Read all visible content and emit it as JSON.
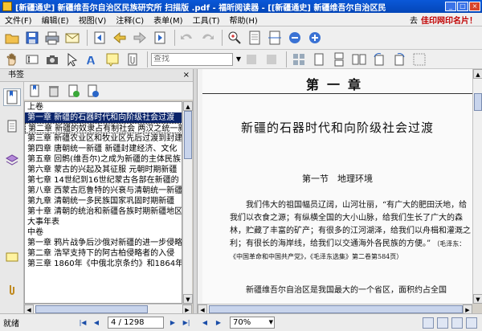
{
  "window": {
    "title": "[新疆通史] 新疆维吾尔自治区民族研究所 扫描版 .pdf - 福昕阅读器 - [[新疆通史] 新疆维吾尔自治区民"
  },
  "menu": {
    "items": [
      "文件(F)",
      "编辑(E)",
      "视图(V)",
      "注释(C)",
      "表单(M)",
      "工具(T)",
      "帮助(H)"
    ],
    "promo_prefix": "去",
    "promo_text": "佳印网印名片！"
  },
  "toolbar": {
    "search_placeholder": "查找",
    "icons": [
      "open-folder-icon",
      "save-icon",
      "print-icon",
      "email-icon",
      "first-page-icon",
      "previous-page-icon",
      "next-page-icon",
      "last-page-icon",
      "back-icon",
      "forward-icon",
      "zoom-in-icon",
      "fit-page-icon",
      "fit-width-icon",
      "zoom-out-icon",
      "zoom-options-icon"
    ]
  },
  "panel": {
    "title": "书签",
    "close_label": "×",
    "bookmarks": [
      "上卷",
      "第一章 新疆的石器时代和向阶级社会过渡",
      "第二章 新疆的奴隶占有制社会 两汉之统一新疆",
      "第三章 新疆农业区和牧业区先后过渡到封建",
      "第四章 唐朝统一新疆 新疆封建经济、文化",
      "第五章 回鹘(维吾尔)之成为新疆的主体民族",
      "第六章 蒙古的兴起及其征服 元朝时期新疆",
      "第七章 14世纪到16世纪蒙古各部在新疆的",
      "第八章 西蒙古厄鲁特的兴衰与清朝统一新疆",
      "第九章 清朝统一多民族国家巩固时期新疆",
      "第十章 清朝的统治和新疆各族时期新疆地区",
      "大事年表",
      "中卷",
      "第一章 鸦片战争后沙俄对新疆的进一步侵略",
      "第二章 浩罕支持下的阿古柏侵略者的入侵",
      "第三章 1860年《中俄北京条约》和1864年"
    ]
  },
  "document": {
    "chapter": "第一章",
    "chapter_title": "新疆的石器时代和向阶级社会过渡",
    "section": "第一节　地理环境",
    "para1": "我们伟大的祖国幅员辽阔，山河壮丽，“有广大的肥田沃地，给我们以衣食之源；有纵横全国的大小山脉，给我们生长了广大的森林，贮藏了丰富的矿产；有很多的江河湖泽，给我们以舟楫和灌溉之利；有很长的海岸线，给我们以交通海外各民族的方便。”",
    "note1": "（毛泽东：《中国革命和中国共产党》，《毛泽东选集》第二卷第584页）",
    "para2": "新疆维吾尔自治区是我国最大的一个省区，面积约占全国"
  },
  "status": {
    "text": "就绪",
    "page_display": "4 / 1298",
    "current_page": 4,
    "total_pages": 1298,
    "zoom": "70%"
  }
}
